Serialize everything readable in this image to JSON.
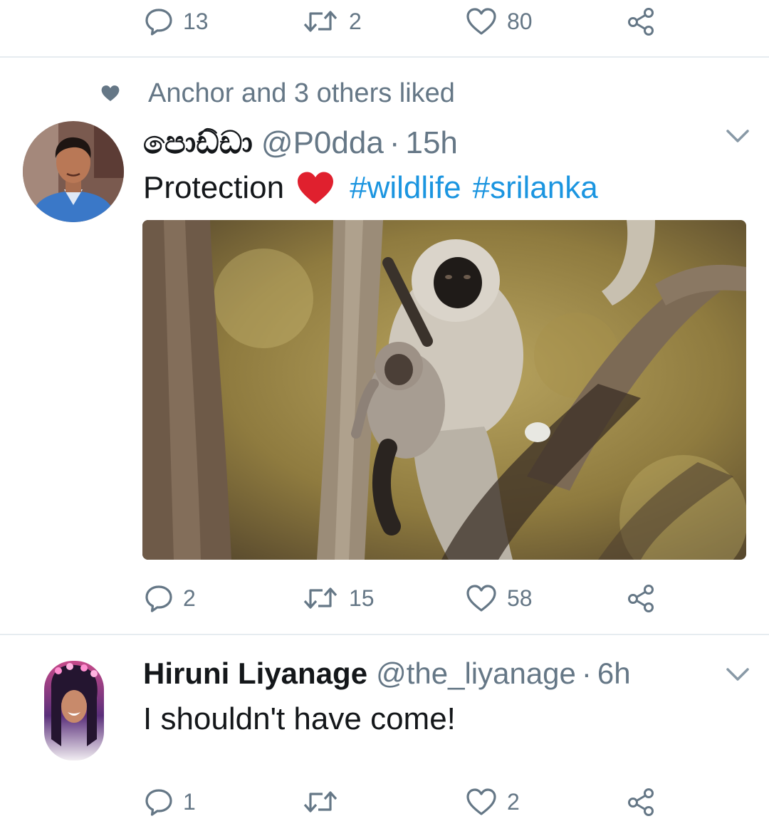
{
  "top_actions": {
    "reply_count": "13",
    "retweet_count": "2",
    "like_count": "80"
  },
  "tweet1": {
    "social_context": "Anchor and 3 others liked",
    "display_name": "පොඩ්ඩා",
    "handle": "@P0dda",
    "separator": "·",
    "time": "15h",
    "text": "Protection",
    "emoji": "❤️",
    "hashtags": [
      "#wildlife",
      "#srilanka"
    ],
    "reply_count": "2",
    "retweet_count": "15",
    "like_count": "58"
  },
  "tweet2": {
    "display_name": "Hiruni Liyanage",
    "handle": "@the_liyanage",
    "separator": "·",
    "time": "6h",
    "text": "I shouldn't have come!",
    "reply_count": "1",
    "retweet_count": "",
    "like_count": "2"
  },
  "colors": {
    "text": "#14171a",
    "secondary": "#657786",
    "link": "#1b95e0",
    "divider": "#e6ecf0"
  },
  "icons": [
    "reply-icon",
    "retweet-icon",
    "like-icon",
    "share-icon",
    "heart-small-icon",
    "chevron-down-icon"
  ]
}
